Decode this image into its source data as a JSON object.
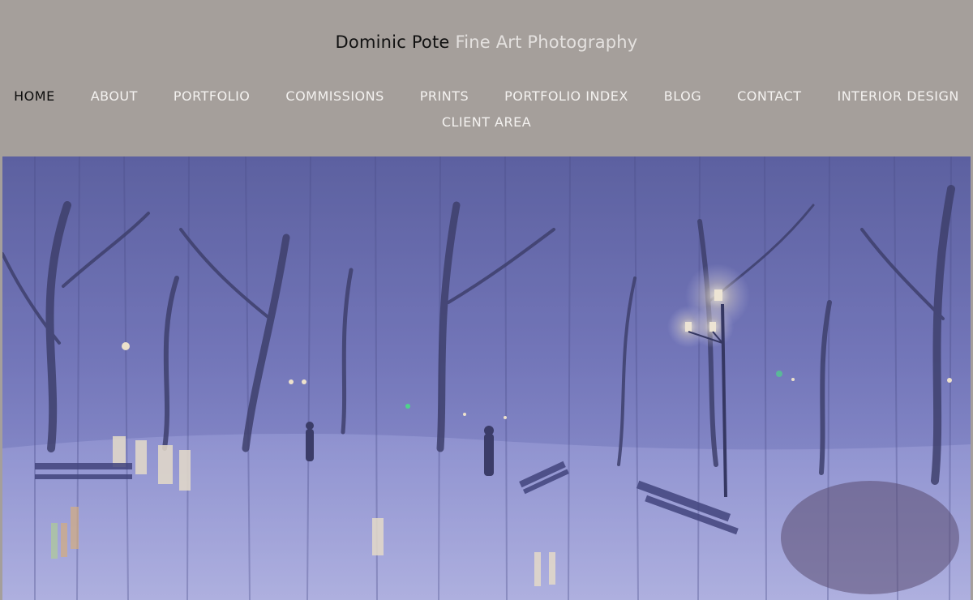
{
  "site": {
    "name": "Dominic Pote",
    "tagline": "Fine Art Photography"
  },
  "nav": {
    "items": [
      {
        "label": "HOME",
        "active": true
      },
      {
        "label": "ABOUT"
      },
      {
        "label": "PORTFOLIO"
      },
      {
        "label": "COMMISSIONS"
      },
      {
        "label": "PRINTS"
      },
      {
        "label": "PORTFOLIO INDEX"
      },
      {
        "label": "BLOG"
      },
      {
        "label": "CONTACT"
      },
      {
        "label": "INTERIOR DESIGN"
      },
      {
        "label": "CLIENT AREA"
      }
    ]
  },
  "colors": {
    "header_bg": "#a59f9b",
    "nav_text": "#f4f2f0",
    "nav_active": "#0d0d0d",
    "tagline": "#e4e1df"
  }
}
